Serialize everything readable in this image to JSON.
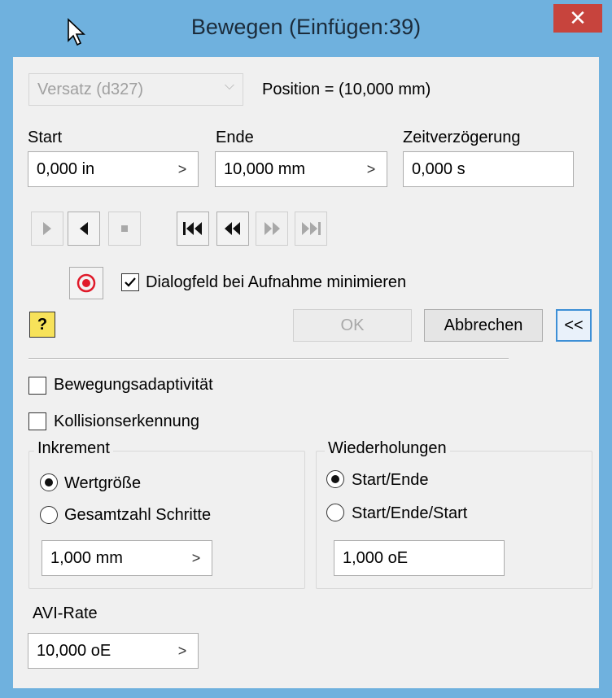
{
  "window": {
    "title": "Bewegen (Einfügen:39)",
    "close_symbol": "✕",
    "accent_color": "#6fb1de",
    "close_color": "#c7443d"
  },
  "constraint": {
    "dropdown_value": "Versatz (d327)",
    "position_text": "Position = (10,000 mm)"
  },
  "fields": {
    "start_label": "Start",
    "start_value": "0,000 in",
    "end_label": "Ende",
    "end_value": "10,000 mm",
    "delay_label": "Zeitverzögerung",
    "delay_value": "0,000 s"
  },
  "playback": {
    "forward_icon": "play-forward-icon",
    "reverse_icon": "play-reverse-icon",
    "stop_icon": "stop-icon",
    "rewind_start_icon": "rewind-to-start-icon",
    "step_back_icon": "step-back-icon",
    "step_forward_icon": "step-forward-icon",
    "forward_end_icon": "forward-to-end-icon"
  },
  "record": {
    "minimize_label": "Dialogfeld bei Aufnahme minimieren",
    "minimize_checked": true
  },
  "buttons": {
    "help": "?",
    "ok": "OK",
    "cancel": "Abbrechen",
    "collapse": "<<"
  },
  "options": {
    "adaptivity_label": "Bewegungsadaptivität",
    "adaptivity_checked": false,
    "collision_label": "Kollisionserkennung",
    "collision_checked": false
  },
  "increment": {
    "title": "Inkrement",
    "option1": "Wertgröße",
    "option2": "Gesamtzahl Schritte",
    "selected": "Wertgröße",
    "value": "1,000 mm"
  },
  "repetitions": {
    "title": "Wiederholungen",
    "option1": "Start/Ende",
    "option2": "Start/Ende/Start",
    "selected": "Start/Ende",
    "value": "1,000 oE"
  },
  "avi": {
    "label": "AVI-Rate",
    "value": "10,000 oE"
  },
  "arrow_symbol": ">",
  "dropdown_symbol": "⌵"
}
